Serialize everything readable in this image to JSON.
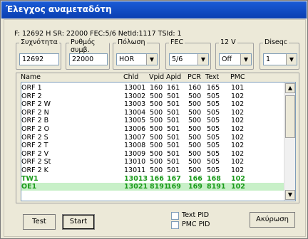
{
  "window": {
    "title": "Έλεγχος αναμεταδότη"
  },
  "status_line": "F: 12692 H SR: 22000 FEC:5/6 NetId:1117 TSId: 1",
  "fields": {
    "frequency": {
      "label": "Συχνότητα",
      "value": "12692"
    },
    "symbol_rate": {
      "label": "Ρυθμός συμβ.",
      "value": "22000"
    },
    "polarity": {
      "label": "Πόλωση",
      "value": "HOR"
    },
    "fec": {
      "label": "FEC",
      "value": "5/6"
    },
    "v12": {
      "label": "12 V",
      "value": "Off"
    },
    "diseqc": {
      "label": "Diseqc",
      "value": "1"
    }
  },
  "table": {
    "columns": [
      "Name",
      "Chld",
      "Vpid",
      "Apid",
      "PCR",
      "Text",
      "PMC"
    ],
    "rows": [
      [
        "ORF 1",
        "13001",
        "160",
        "161",
        "160",
        "165",
        "101"
      ],
      [
        "ORF 2",
        "13002",
        "500",
        "501",
        "500",
        "505",
        "102"
      ],
      [
        "ORF 2 W",
        "13003",
        "500",
        "501",
        "500",
        "505",
        "102"
      ],
      [
        "ORF 2 N",
        "13004",
        "500",
        "501",
        "500",
        "505",
        "102"
      ],
      [
        "ORF 2 B",
        "13005",
        "500",
        "501",
        "500",
        "505",
        "102"
      ],
      [
        "ORF 2 O",
        "13006",
        "500",
        "501",
        "500",
        "505",
        "102"
      ],
      [
        "ORF 2 S",
        "13007",
        "500",
        "501",
        "500",
        "505",
        "102"
      ],
      [
        "ORF 2 T",
        "13008",
        "500",
        "501",
        "500",
        "505",
        "102"
      ],
      [
        "ORF 2 V",
        "13009",
        "500",
        "501",
        "500",
        "505",
        "102"
      ],
      [
        "ORF 2 St",
        "13010",
        "500",
        "501",
        "500",
        "505",
        "102"
      ],
      [
        "ORF 2 K",
        "13011",
        "500",
        "501",
        "500",
        "505",
        "102"
      ],
      [
        "TW1",
        "13013",
        "166",
        "167",
        "166",
        "168",
        "102"
      ],
      [
        "OE1",
        "13021",
        "8191",
        "169",
        "169",
        "8191",
        "102"
      ]
    ]
  },
  "buttons": {
    "test": "Test",
    "start": "Start",
    "cancel": "Ακύρωση"
  },
  "checks": {
    "text_pid": "Text PID",
    "pmc_pid": "PMC PID"
  }
}
